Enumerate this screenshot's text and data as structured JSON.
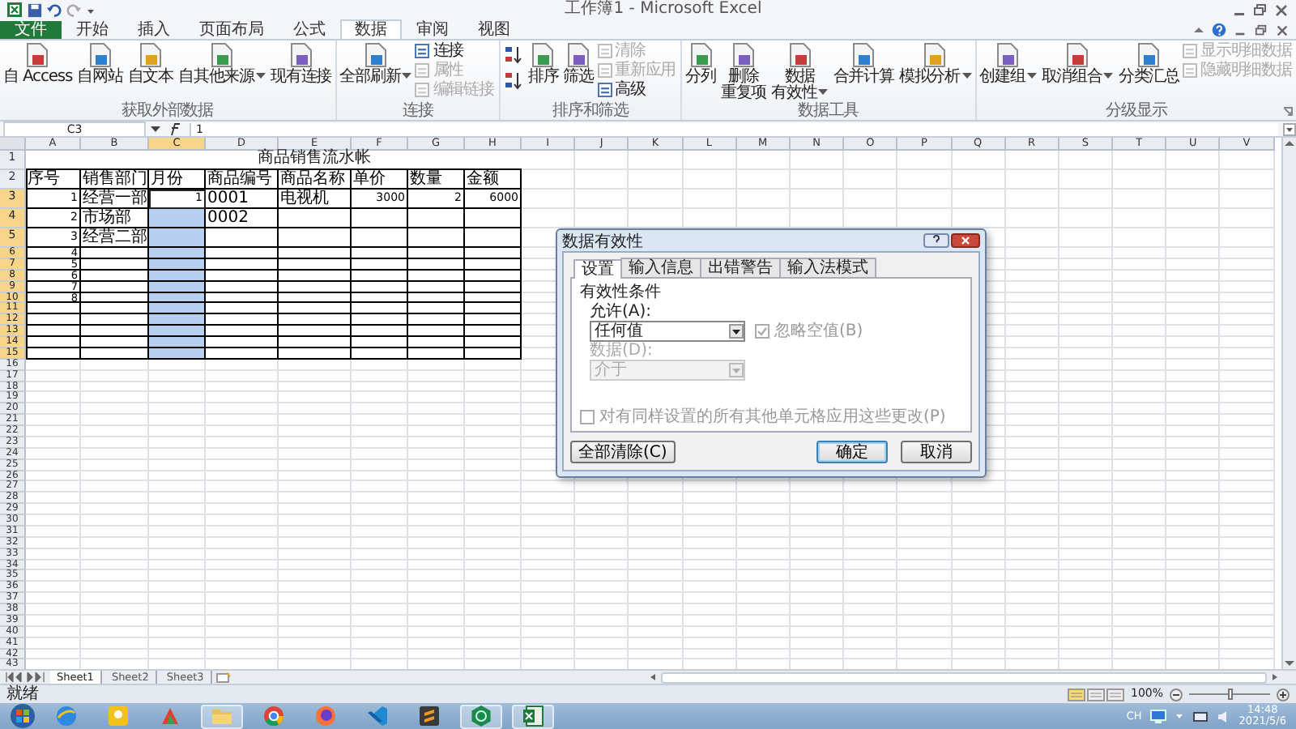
{
  "window": {
    "title": "工作簿1 - Microsoft Excel"
  },
  "tabs": [
    {
      "label": "文件",
      "selected": false,
      "kind": "file"
    },
    {
      "label": "开始",
      "selected": false,
      "kind": "tab"
    },
    {
      "label": "插入",
      "selected": false,
      "kind": "tab"
    },
    {
      "label": "页面布局",
      "selected": false,
      "kind": "tab"
    },
    {
      "label": "公式",
      "selected": false,
      "kind": "tab"
    },
    {
      "label": "数据",
      "selected": true,
      "kind": "tab"
    },
    {
      "label": "审阅",
      "selected": false,
      "kind": "tab"
    },
    {
      "label": "视图",
      "selected": false,
      "kind": "tab"
    }
  ],
  "ribbon_groups": [
    {
      "label": "获取外部数据",
      "launcher": false,
      "items": [
        {
          "kind": "large",
          "lines": [
            "自 Access"
          ],
          "disabled": false,
          "dropdown": false
        },
        {
          "kind": "large",
          "lines": [
            "自网站"
          ],
          "disabled": false,
          "dropdown": false
        },
        {
          "kind": "large",
          "lines": [
            "自文本"
          ],
          "disabled": false,
          "dropdown": false
        },
        {
          "kind": "large",
          "lines": [
            "自其他来源"
          ],
          "disabled": false,
          "dropdown": true
        },
        {
          "kind": "large",
          "lines": [
            "现有连接"
          ],
          "disabled": false,
          "dropdown": false
        }
      ]
    },
    {
      "label": "连接",
      "launcher": false,
      "items": [
        {
          "kind": "large",
          "lines": [
            "全部刷新"
          ],
          "disabled": false,
          "dropdown": true
        },
        {
          "kind": "stack",
          "entries": [
            {
              "label": "连接",
              "disabled": false
            },
            {
              "label": "属性",
              "disabled": true
            },
            {
              "label": "编辑链接",
              "disabled": true
            }
          ]
        }
      ]
    },
    {
      "label": "排序和筛选",
      "launcher": false,
      "items": [
        {
          "kind": "sort"
        },
        {
          "kind": "large",
          "lines": [
            "排序"
          ],
          "disabled": false,
          "dropdown": false
        },
        {
          "kind": "large",
          "lines": [
            "筛选"
          ],
          "disabled": false,
          "dropdown": false
        },
        {
          "kind": "stack",
          "entries": [
            {
              "label": "清除",
              "disabled": true
            },
            {
              "label": "重新应用",
              "disabled": true
            },
            {
              "label": "高级",
              "disabled": false
            }
          ]
        }
      ]
    },
    {
      "label": "数据工具",
      "launcher": false,
      "items": [
        {
          "kind": "large",
          "lines": [
            "分列"
          ],
          "disabled": false,
          "dropdown": false
        },
        {
          "kind": "large",
          "lines": [
            "删除",
            "重复项"
          ],
          "disabled": false,
          "dropdown": false
        },
        {
          "kind": "large",
          "lines": [
            "数据",
            "有效性"
          ],
          "disabled": false,
          "dropdown": true
        },
        {
          "kind": "large",
          "lines": [
            "合并计算"
          ],
          "disabled": false,
          "dropdown": false
        },
        {
          "kind": "large",
          "lines": [
            "模拟分析"
          ],
          "disabled": false,
          "dropdown": true
        }
      ]
    },
    {
      "label": "分级显示",
      "launcher": true,
      "items": [
        {
          "kind": "large",
          "lines": [
            "创建组"
          ],
          "disabled": false,
          "dropdown": true
        },
        {
          "kind": "large",
          "lines": [
            "取消组合"
          ],
          "disabled": false,
          "dropdown": true
        },
        {
          "kind": "large",
          "lines": [
            "分类汇总"
          ],
          "disabled": false,
          "dropdown": false
        },
        {
          "kind": "stack",
          "entries": [
            {
              "label": "显示明细数据",
              "disabled": true
            },
            {
              "label": "隐藏明细数据",
              "disabled": true
            }
          ]
        }
      ]
    }
  ],
  "sheet": {
    "name_box": "C3",
    "formula": "1",
    "columns": [
      {
        "label": "A",
        "selected": false
      },
      {
        "label": "B",
        "selected": false
      },
      {
        "label": "C",
        "selected": true
      },
      {
        "label": "D",
        "selected": false
      },
      {
        "label": "E",
        "selected": false
      },
      {
        "label": "F",
        "selected": false
      },
      {
        "label": "G",
        "selected": false
      },
      {
        "label": "H",
        "selected": false
      },
      {
        "label": "I",
        "selected": false
      },
      {
        "label": "J",
        "selected": false
      },
      {
        "label": "K",
        "selected": false
      },
      {
        "label": "L",
        "selected": false
      },
      {
        "label": "M",
        "selected": false
      },
      {
        "label": "N",
        "selected": false
      },
      {
        "label": "O",
        "selected": false
      },
      {
        "label": "P",
        "selected": false
      },
      {
        "label": "Q",
        "selected": false
      },
      {
        "label": "R",
        "selected": false
      },
      {
        "label": "S",
        "selected": false
      },
      {
        "label": "T",
        "selected": false
      },
      {
        "label": "U",
        "selected": false
      },
      {
        "label": "V",
        "selected": false
      }
    ],
    "rows": [
      {
        "label": "1",
        "selected": false
      },
      {
        "label": "2",
        "selected": false
      },
      {
        "label": "3",
        "selected": true
      },
      {
        "label": "4",
        "selected": true
      },
      {
        "label": "5",
        "selected": true
      },
      {
        "label": "6",
        "selected": true
      },
      {
        "label": "7",
        "selected": true
      },
      {
        "label": "8",
        "selected": true
      },
      {
        "label": "9",
        "selected": true
      },
      {
        "label": "10",
        "selected": true
      },
      {
        "label": "11",
        "selected": true
      },
      {
        "label": "12",
        "selected": true
      },
      {
        "label": "13",
        "selected": true
      },
      {
        "label": "14",
        "selected": true
      },
      {
        "label": "15",
        "selected": true
      },
      {
        "label": "16",
        "selected": false
      },
      {
        "label": "17",
        "selected": false
      },
      {
        "label": "18",
        "selected": false
      },
      {
        "label": "19",
        "selected": false
      },
      {
        "label": "20",
        "selected": false
      },
      {
        "label": "21",
        "selected": false
      },
      {
        "label": "22",
        "selected": false
      },
      {
        "label": "23",
        "selected": false
      },
      {
        "label": "24",
        "selected": false
      },
      {
        "label": "25",
        "selected": false
      },
      {
        "label": "26",
        "selected": false
      },
      {
        "label": "27",
        "selected": false
      },
      {
        "label": "28",
        "selected": false
      },
      {
        "label": "29",
        "selected": false
      },
      {
        "label": "30",
        "selected": false
      },
      {
        "label": "31",
        "selected": false
      },
      {
        "label": "32",
        "selected": false
      },
      {
        "label": "33",
        "selected": false
      },
      {
        "label": "34",
        "selected": false
      },
      {
        "label": "35",
        "selected": false
      },
      {
        "label": "36",
        "selected": false
      },
      {
        "label": "37",
        "selected": false
      },
      {
        "label": "38",
        "selected": false
      },
      {
        "label": "39",
        "selected": false
      },
      {
        "label": "40",
        "selected": false
      },
      {
        "label": "41",
        "selected": false
      },
      {
        "label": "42",
        "selected": false
      },
      {
        "label": "43",
        "selected": false
      }
    ],
    "title": "商品销售流水帐",
    "header": [
      "序号",
      "销售部门",
      "月份",
      "商品编号",
      "商品名称",
      "单价",
      "数量",
      "金额"
    ],
    "records": [
      [
        {
          "text": "1",
          "kind": "number"
        },
        {
          "text": "经营一部",
          "kind": "text"
        },
        {
          "text": "1",
          "kind": "number"
        },
        {
          "text": "0001",
          "kind": "text"
        },
        {
          "text": "电视机",
          "kind": "text"
        },
        {
          "text": "3000",
          "kind": "number"
        },
        {
          "text": "2",
          "kind": "number"
        },
        {
          "text": "6000",
          "kind": "number"
        }
      ],
      [
        {
          "text": "2",
          "kind": "number"
        },
        {
          "text": "市场部",
          "kind": "text"
        },
        {
          "kind": "blank"
        },
        {
          "text": "0002",
          "kind": "text"
        }
      ],
      [
        {
          "text": "3",
          "kind": "number"
        },
        {
          "text": "经营二部",
          "kind": "text"
        }
      ],
      [
        {
          "text": "4",
          "kind": "number"
        }
      ],
      [
        {
          "text": "5",
          "kind": "number"
        }
      ],
      [
        {
          "text": "6",
          "kind": "number"
        }
      ],
      [
        {
          "text": "7",
          "kind": "number"
        }
      ],
      [
        {
          "text": "8",
          "kind": "number"
        }
      ]
    ]
  },
  "dialog": {
    "title": "数据有效性",
    "tabs": [
      {
        "label": "设置",
        "selected": true
      },
      {
        "label": "输入信息",
        "selected": false
      },
      {
        "label": "出错警告",
        "selected": false
      },
      {
        "label": "输入法模式",
        "selected": false
      }
    ],
    "section": "有效性条件",
    "allow": {
      "label": "允许(A):",
      "value": "任何值"
    },
    "ignore_blank": {
      "label": "忽略空值(B)",
      "checked": true,
      "disabled": true
    },
    "data": {
      "label": "数据(D):",
      "value": "介于",
      "disabled": true
    },
    "apply_all": {
      "label": "对有同样设置的所有其他单元格应用这些更改(P)",
      "checked": false,
      "disabled": true
    },
    "buttons": [
      {
        "label": "全部清除(C)",
        "kind": "left"
      },
      {
        "label": "确定",
        "kind": "default"
      },
      {
        "label": "取消",
        "kind": "normal"
      }
    ]
  },
  "sheet_tabs": [
    {
      "label": "Sheet1",
      "selected": true
    },
    {
      "label": "Sheet2",
      "selected": false
    },
    {
      "label": "Sheet3",
      "selected": false
    }
  ],
  "status_bar": {
    "text": "就绪",
    "views": [
      {
        "selected": true
      },
      {
        "selected": false
      },
      {
        "selected": false
      }
    ],
    "zoom": "100%",
    "level": 0.5
  },
  "taskbar": {
    "apps": [
      {
        "kind": "globe",
        "active": false
      },
      {
        "kind": "badge",
        "active": false
      },
      {
        "kind": "paint",
        "active": false
      },
      {
        "kind": "folder",
        "active": true
      },
      {
        "kind": "chrome",
        "active": false
      },
      {
        "kind": "firefox",
        "active": false
      },
      {
        "kind": "code",
        "active": false
      },
      {
        "kind": "editor",
        "active": false
      },
      {
        "kind": "hexagon",
        "active": true
      },
      {
        "kind": "excel",
        "active": true
      }
    ],
    "language": "CH",
    "time": "14:48",
    "date": "2021/5/6"
  }
}
